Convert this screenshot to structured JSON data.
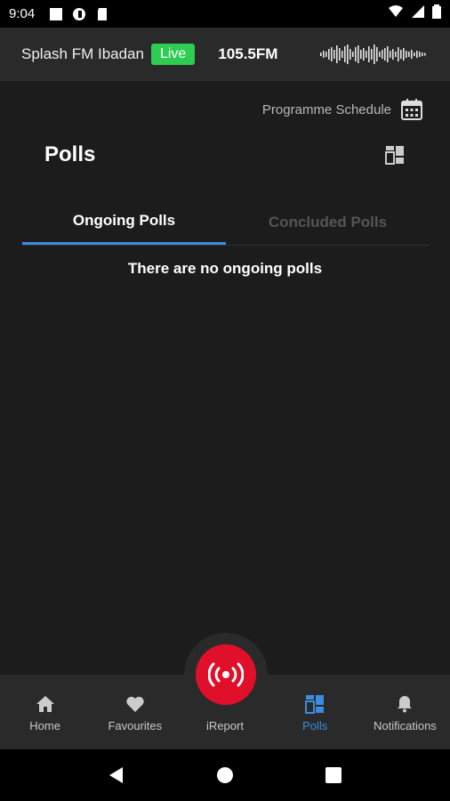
{
  "status_bar": {
    "time": "9:04"
  },
  "radio_bar": {
    "station": "Splash FM Ibadan",
    "live_badge": "Live",
    "frequency": "105.5FM",
    "live_color": "#2ecc52"
  },
  "schedule": {
    "label": "Programme Schedule"
  },
  "page": {
    "title": "Polls"
  },
  "tabs": [
    {
      "label": "Ongoing Polls",
      "active": true
    },
    {
      "label": "Concluded Polls",
      "active": false
    }
  ],
  "empty_message": "There are no ongoing polls",
  "bottom_nav": {
    "items": [
      {
        "label": "Home",
        "icon": "home-icon"
      },
      {
        "label": "Favourites",
        "icon": "heart-icon"
      },
      {
        "label": "iReport",
        "icon": "broadcast-icon"
      },
      {
        "label": "Polls",
        "icon": "polls-icon",
        "active": true
      },
      {
        "label": "Notifications",
        "icon": "bell-icon"
      }
    ]
  },
  "colors": {
    "accent": "#3a8de0",
    "fab": "#e0102a",
    "background": "#1c1c1c"
  }
}
